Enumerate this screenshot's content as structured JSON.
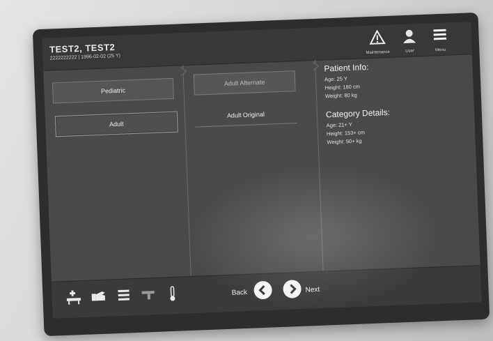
{
  "header": {
    "patient_name": "TEST2, TEST2",
    "patient_sub": "2222222222 | 1996-02-02 (25 Y)",
    "maintenance_label": "Maintenance",
    "user_label": "User",
    "menu_label": "Menu"
  },
  "categories": {
    "pediatric": "Pediatric",
    "adult": "Adult"
  },
  "subcategories": {
    "adult_alternate": "Adult Alternate",
    "adult_original": "Adult Original"
  },
  "patient_info": {
    "title": "Patient Info:",
    "age": "Age: 25 Y",
    "height": "Height: 180 cm",
    "weight": "Weight: 80 kg"
  },
  "category_details": {
    "title": "Category Details:",
    "age": "Age: 21+ Y",
    "height": "Height: 153+ cm",
    "weight": "Weight: 50+ kg"
  },
  "footer": {
    "back_label": "Back",
    "next_label": "Next",
    "icons": [
      "patient-add-icon",
      "hand-icon",
      "list-icon",
      "gun-icon",
      "thermometer-icon"
    ]
  }
}
